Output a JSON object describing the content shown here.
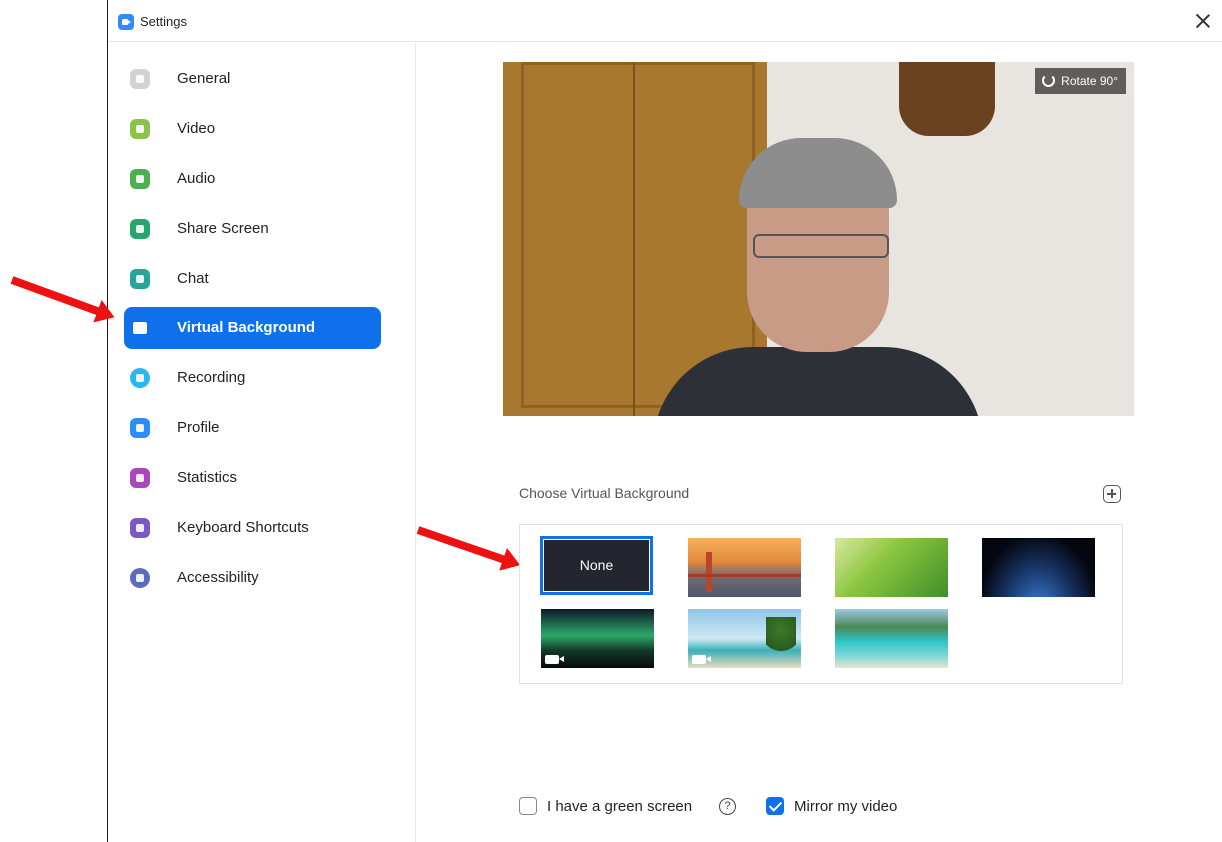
{
  "window": {
    "title": "Settings",
    "icon": "zoom-app-icon"
  },
  "sidebar": {
    "items": [
      {
        "label": "General",
        "icon": "gear-icon",
        "color": "#d2d2d2"
      },
      {
        "label": "Video",
        "icon": "video-camera-icon",
        "color": "#8bc34a"
      },
      {
        "label": "Audio",
        "icon": "headphones-icon",
        "color": "#4caf50"
      },
      {
        "label": "Share Screen",
        "icon": "share-screen-icon",
        "color": "#26a66b"
      },
      {
        "label": "Chat",
        "icon": "chat-bubble-icon",
        "color": "#26a69a"
      },
      {
        "label": "Virtual Background",
        "icon": "virtual-background-icon",
        "color": "#0e71eb",
        "active": true
      },
      {
        "label": "Recording",
        "icon": "record-icon",
        "color": "#29b6f6"
      },
      {
        "label": "Profile",
        "icon": "profile-icon",
        "color": "#2d8cff"
      },
      {
        "label": "Statistics",
        "icon": "bar-chart-icon",
        "color": "#ab47bc"
      },
      {
        "label": "Keyboard Shortcuts",
        "icon": "keyboard-icon",
        "color": "#7e57c2"
      },
      {
        "label": "Accessibility",
        "icon": "accessibility-icon",
        "color": "#5c6bc0"
      }
    ]
  },
  "preview": {
    "rotate_label": "Rotate 90°"
  },
  "backgrounds": {
    "heading": "Choose Virtual Background",
    "add_icon": "plus-icon",
    "items": [
      {
        "label": "None",
        "selected": true
      },
      {
        "name": "golden-gate-bridge"
      },
      {
        "name": "green-grass"
      },
      {
        "name": "earth-from-space"
      },
      {
        "name": "northern-lights",
        "video": true
      },
      {
        "name": "palm-beach",
        "video": true
      },
      {
        "name": "tropical-beach"
      }
    ]
  },
  "options": {
    "green_screen_label": "I have a green screen",
    "green_screen_checked": false,
    "help_icon": "?",
    "mirror_label": "Mirror my video",
    "mirror_checked": true
  },
  "colors": {
    "accent": "#0e71eb",
    "annotation_arrow": "#ee1111"
  }
}
